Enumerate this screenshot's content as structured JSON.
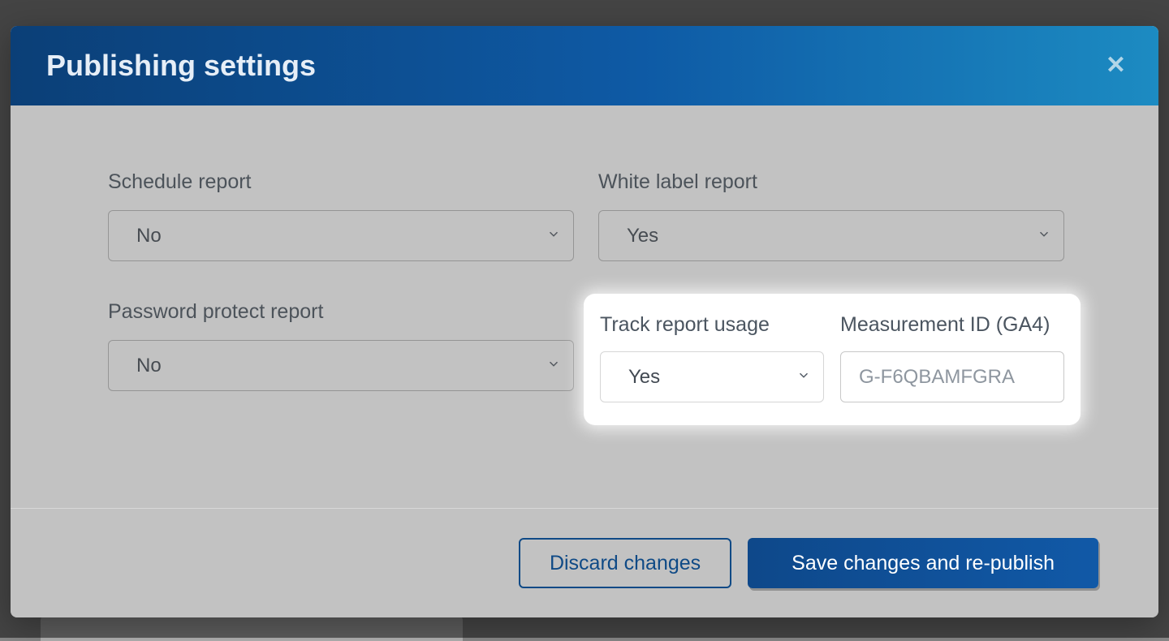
{
  "modal": {
    "title": "Publishing settings",
    "close_symbol": "✕"
  },
  "fields": {
    "schedule_report": {
      "label": "Schedule report",
      "value": "No"
    },
    "white_label_report": {
      "label": "White label report",
      "value": "Yes"
    },
    "password_protect": {
      "label": "Password protect report",
      "value": "No"
    },
    "track_usage": {
      "label": "Track report usage",
      "value": "Yes"
    },
    "measurement_id": {
      "label": "Measurement ID (GA4)",
      "placeholder": "G-F6QBAMFGRA",
      "value": ""
    }
  },
  "footer": {
    "discard_label": "Discard changes",
    "save_label": "Save changes and re-publish"
  }
}
